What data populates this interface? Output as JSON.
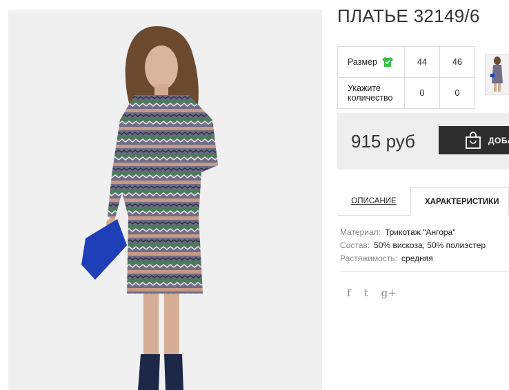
{
  "product": {
    "title": "ПЛАТЬЕ 32149/6",
    "image_alt": "Model in patterned knit dress holding blue clutch"
  },
  "sizes": {
    "size_label": "Размер",
    "size_icon": "shirt-check-icon",
    "size_icon_color": "#3cbf4a",
    "options": [
      "44",
      "46"
    ],
    "quantity_label": "Укажите количество",
    "quantities": [
      "0",
      "0"
    ]
  },
  "purchase": {
    "price": "915 руб",
    "cart_label": "ДОБАВИТЬ В КОРЗИНУ",
    "cart_icon": "shopping-bag-icon",
    "button_color": "#2d2d2d"
  },
  "tabs": [
    {
      "label": "ОПИСАНИЕ",
      "active": false
    },
    {
      "label": "ХАРАКТЕРИСТИКИ",
      "active": true
    }
  ],
  "specs": [
    {
      "key": "Материал:",
      "value": "Трикотаж \"Ангора\""
    },
    {
      "key": "Состав:",
      "value": "50% вискоза, 50% полиэстер"
    },
    {
      "key": "Растяжимость:",
      "value": "средняя"
    }
  ],
  "social": [
    {
      "name": "facebook-icon",
      "glyph": "f"
    },
    {
      "name": "twitter-icon",
      "glyph": "t"
    },
    {
      "name": "google-plus-icon",
      "glyph": "g+"
    }
  ]
}
